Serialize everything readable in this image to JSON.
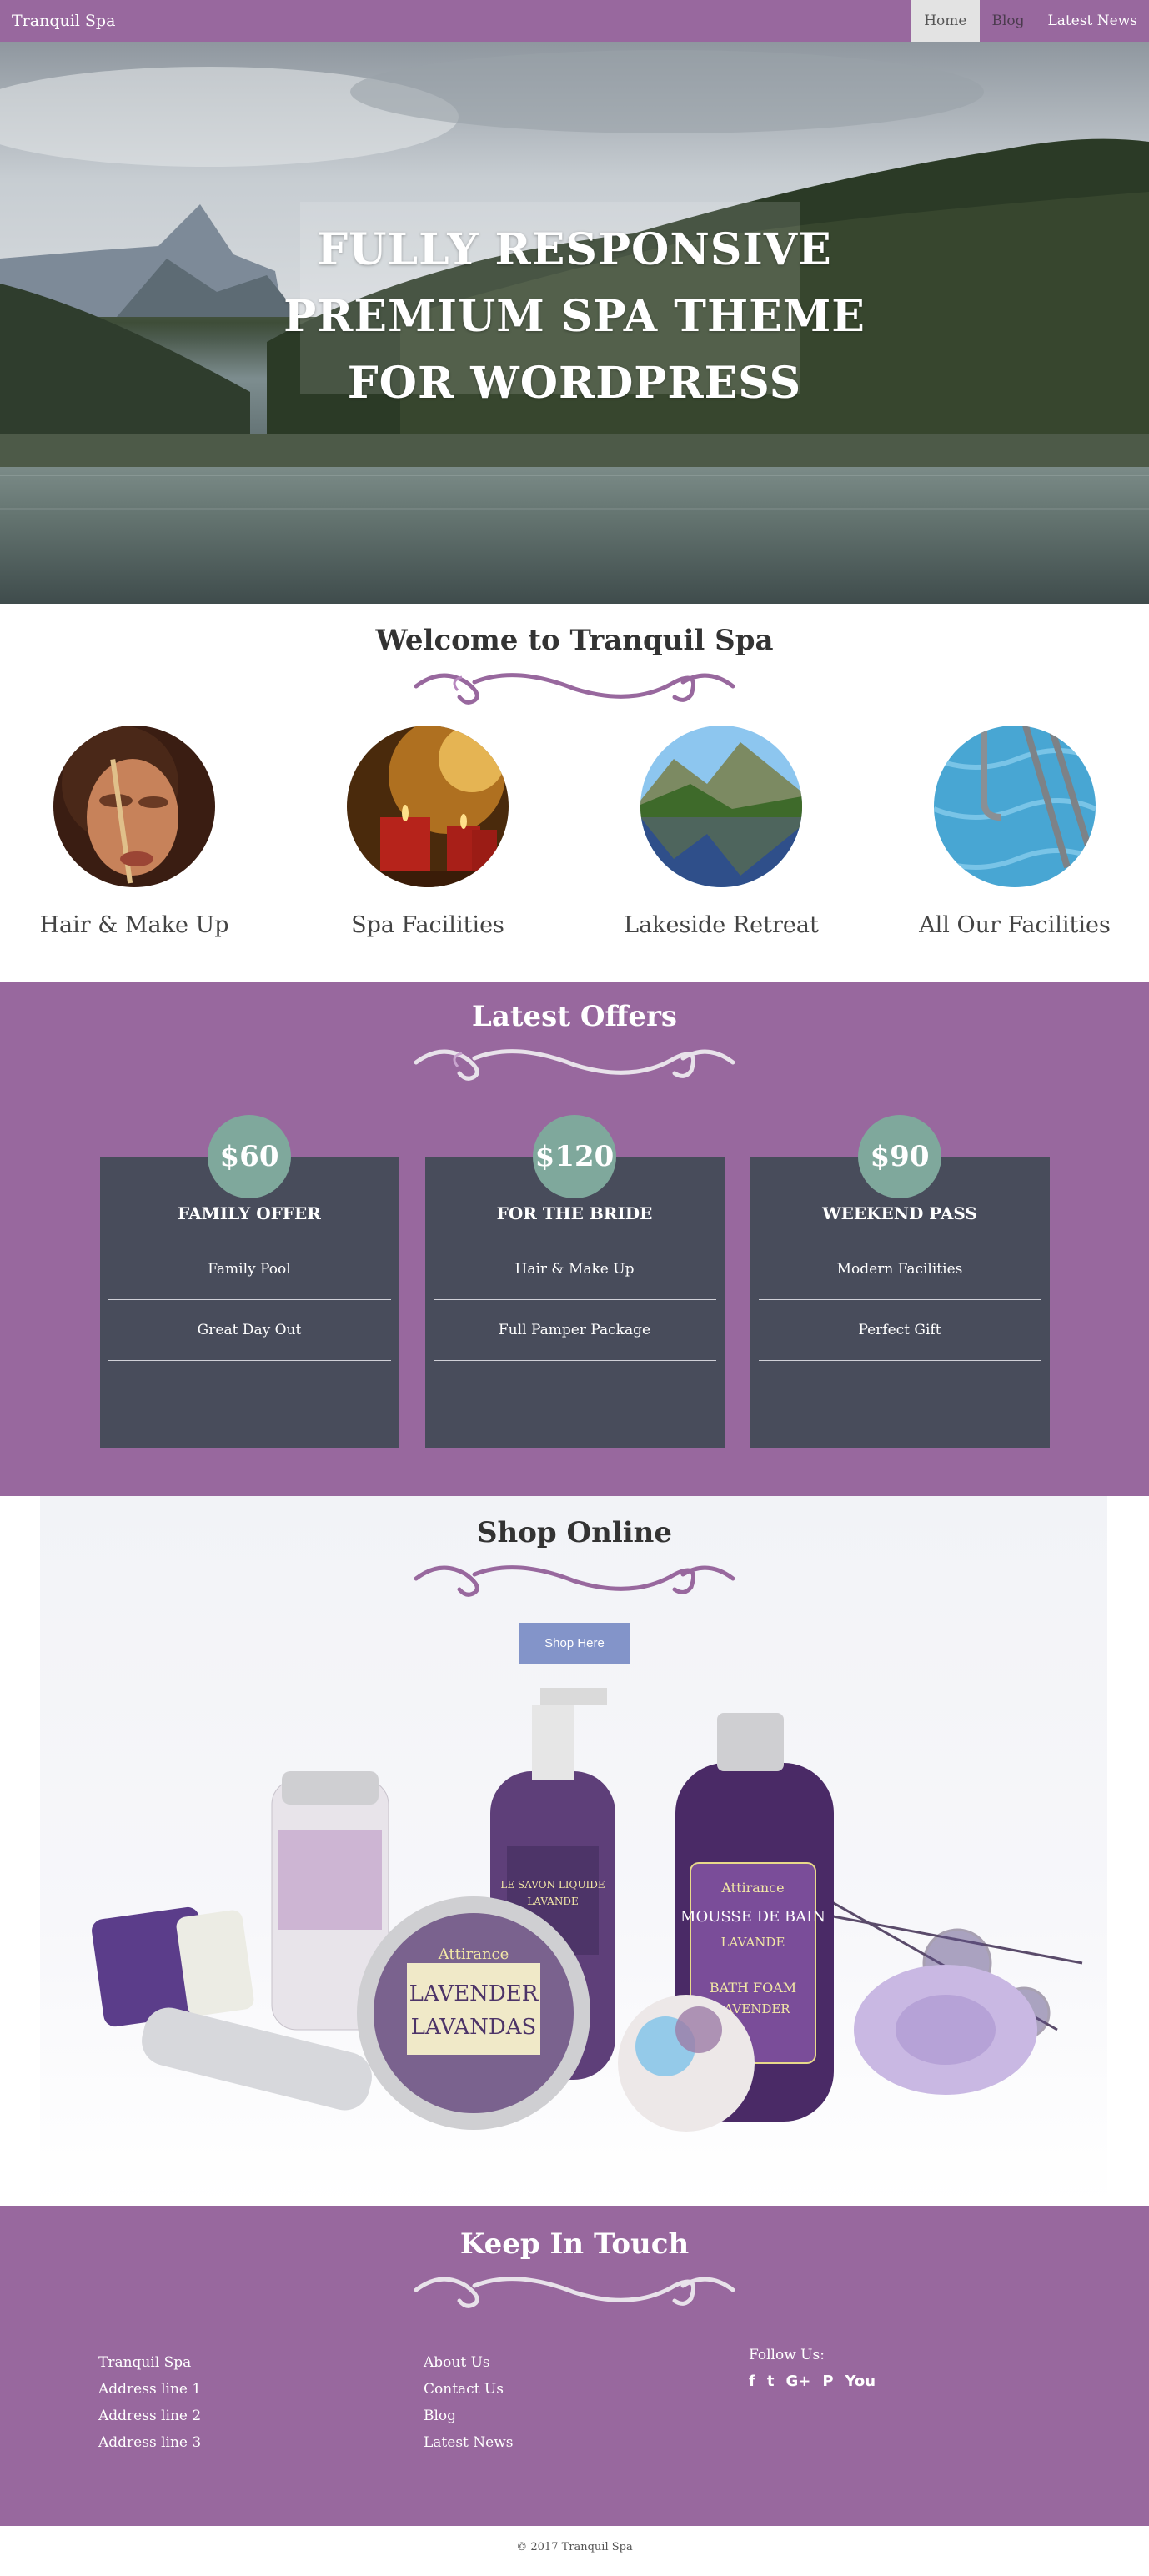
{
  "navbar": {
    "brand": "Tranquil Spa",
    "links": [
      {
        "label": "Home",
        "active": true
      },
      {
        "label": "Blog",
        "active": false
      },
      {
        "label": "Latest News",
        "active": false
      }
    ]
  },
  "hero": {
    "lines": [
      "FULLY RESPONSIVE",
      "PREMIUM SPA THEME",
      "FOR WORDPRESS"
    ]
  },
  "welcome": {
    "title": "Welcome to Tranquil Spa",
    "features": [
      {
        "label": "Hair & Make Up"
      },
      {
        "label": "Spa Facilities"
      },
      {
        "label": "Lakeside Retreat"
      },
      {
        "label": "All Our Facilities"
      }
    ]
  },
  "offers": {
    "title": "Latest Offers",
    "cards": [
      {
        "price": "$60",
        "title": "FAMILY OFFER",
        "items": [
          "Family Pool",
          "Great Day Out"
        ]
      },
      {
        "price": "$120",
        "title": "FOR THE BRIDE",
        "items": [
          "Hair & Make Up",
          "Full Pamper Package"
        ]
      },
      {
        "price": "$90",
        "title": "WEEKEND PASS",
        "items": [
          "Modern Facilities",
          "Perfect Gift"
        ]
      }
    ]
  },
  "shop": {
    "title": "Shop Online",
    "button": "Shop Here",
    "product_text": {
      "tin_top": "Attirance",
      "tin_main1": "LAVENDER",
      "tin_main2": "LAVANDAS",
      "bottle_brand": "Attirance",
      "bottle_line1": "MOUSSE DE BAIN",
      "bottle_line2": "LAVANDE",
      "bottle_line3": "BATH FOAM",
      "bottle_line4": "LAVENDER",
      "pump_line1": "LE SAVON LIQUIDE",
      "pump_line2": "LAVANDE"
    }
  },
  "touch": {
    "title": "Keep In Touch",
    "address": [
      "Tranquil Spa",
      "Address line 1",
      "Address line 2",
      "Address line 3"
    ],
    "links": [
      "About Us",
      "Contact Us",
      "Blog",
      "Latest News"
    ],
    "follow": "Follow Us:",
    "social": [
      {
        "icon": "facebook-icon",
        "glyph": "f"
      },
      {
        "icon": "twitter-icon",
        "glyph": "t"
      },
      {
        "icon": "google-plus-icon",
        "glyph": "G+"
      },
      {
        "icon": "pinterest-icon",
        "glyph": "P"
      },
      {
        "icon": "youtube-icon",
        "glyph": "You"
      }
    ]
  },
  "copyright": "© 2017 Tranquil Spa",
  "colors": {
    "brand": "#98689e",
    "card": "#484c5b",
    "price_badge": "#7fa89c",
    "button": "#8394c9"
  }
}
